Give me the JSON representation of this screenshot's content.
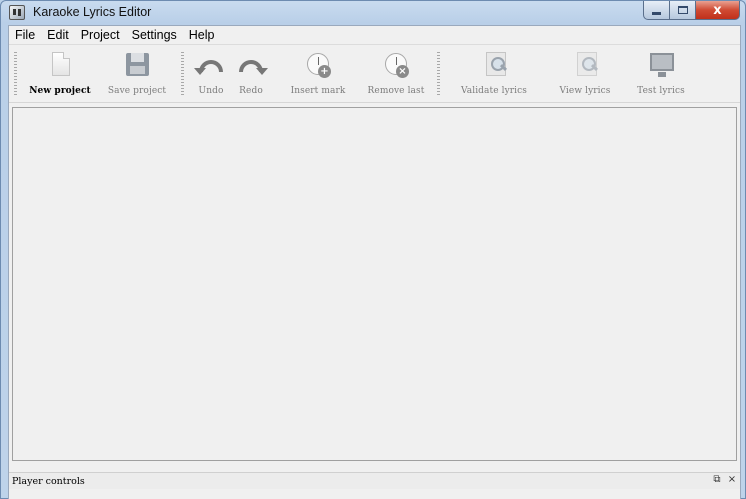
{
  "window": {
    "title": "Karaoke Lyrics Editor",
    "controls": {
      "minimize": "",
      "maximize": "",
      "close": "x"
    }
  },
  "menu": {
    "items": [
      "File",
      "Edit",
      "Project",
      "Settings",
      "Help"
    ]
  },
  "toolbar": {
    "new_project": "New project",
    "save_project": "Save project",
    "undo": "Undo",
    "redo": "Redo",
    "insert_mark": "Insert mark",
    "remove_last": "Remove last",
    "validate_lyrics": "Validate lyrics",
    "view_lyrics": "View lyrics",
    "test_lyrics": "Test lyrics",
    "icons": {
      "new_project": "new-document-icon",
      "save_project": "floppy-disk-icon",
      "undo": "undo-arrow-icon",
      "redo": "redo-arrow-icon",
      "insert_mark": "clock-plus-icon",
      "remove_last": "clock-remove-icon",
      "validate_lyrics": "document-magnifier-icon",
      "view_lyrics": "document-view-icon",
      "test_lyrics": "monitor-icon"
    }
  },
  "dock": {
    "title": "Player controls",
    "float_glyph": "⧉",
    "close_glyph": "×"
  },
  "colors": {
    "frame": "#bcd2ea",
    "client": "#f0f0f0",
    "close_button": "#c0301b"
  }
}
